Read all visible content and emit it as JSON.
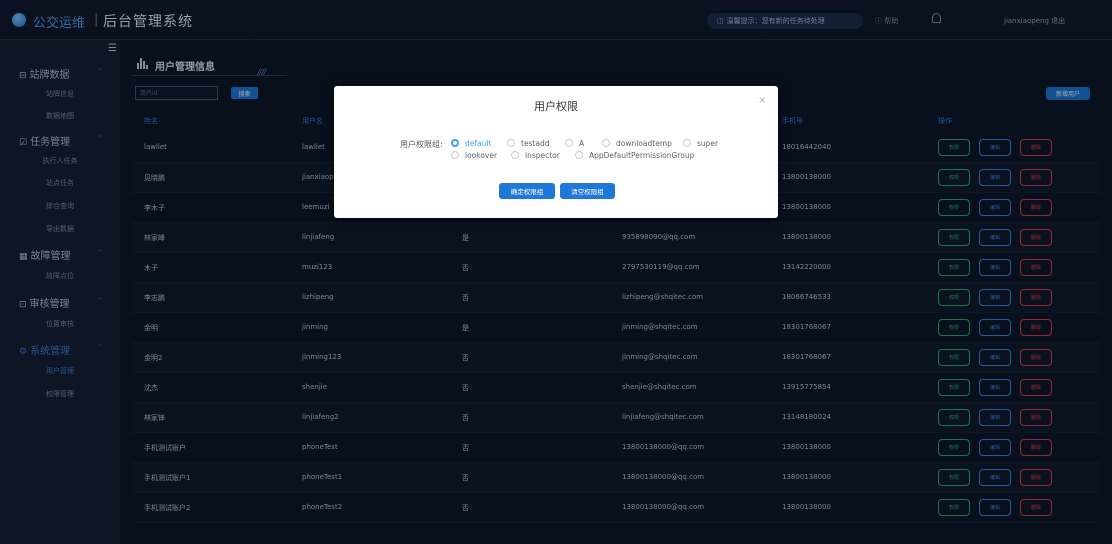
{
  "header": {
    "brand": "公交运维",
    "separator": "|",
    "app_title": "后台管理系统",
    "notice": "温馨提示：您有新的任务待处理",
    "help": "帮助",
    "user": "jianxiaopeng  退出"
  },
  "sidebar": {
    "groups": [
      {
        "label": "站牌数据",
        "items": [
          "站牌信息",
          "数据地图"
        ]
      },
      {
        "label": "任务管理",
        "items": [
          "执行人任务",
          "站点任务",
          "综合查询",
          "导出数据"
        ]
      },
      {
        "label": "故障管理",
        "items": [
          "故障点位"
        ]
      },
      {
        "label": "审核管理",
        "items": [
          "位置审核"
        ]
      },
      {
        "label": "系统管理",
        "items": [
          "用户管理",
          "权限管理"
        ]
      }
    ],
    "active_item": "用户管理"
  },
  "page": {
    "title": "用户管理信息",
    "search_placeholder": "用户id",
    "search_button": "搜索",
    "add_user_button": "新增用户"
  },
  "table": {
    "columns": [
      "姓名",
      "用户名",
      "",
      "",
      "手机号",
      "操作"
    ],
    "op_labels": {
      "permission": "权限",
      "edit": "编辑",
      "delete": "删除"
    },
    "rows": [
      {
        "name": "lawliet",
        "username": "lawliet",
        "flag": "",
        "email": "",
        "phone": "18016442040"
      },
      {
        "name": "见晓鹏",
        "username": "jianxiaop",
        "flag": "",
        "email": "",
        "phone": "13800138000"
      },
      {
        "name": "李木子",
        "username": "leemuzi",
        "flag": "",
        "email": "",
        "phone": "13800138000"
      },
      {
        "name": "林家峰",
        "username": "linjiafeng",
        "flag": "是",
        "email": "935898090@qq.com",
        "phone": "13800138000"
      },
      {
        "name": "木子",
        "username": "muzi123",
        "flag": "否",
        "email": "2797530119@qq.com",
        "phone": "13142220000"
      },
      {
        "name": "李志鹏",
        "username": "lizhipeng",
        "flag": "否",
        "email": "lizhipeng@shqitec.com",
        "phone": "18066746533"
      },
      {
        "name": "金明",
        "username": "jinming",
        "flag": "是",
        "email": "jinming@shqitec.com",
        "phone": "18301768067"
      },
      {
        "name": "金明2",
        "username": "jinming123",
        "flag": "否",
        "email": "jinming@shqitec.com",
        "phone": "18301768067"
      },
      {
        "name": "沈杰",
        "username": "shenjie",
        "flag": "否",
        "email": "shenjie@shqitec.com",
        "phone": "13915775854"
      },
      {
        "name": "林家锋",
        "username": "linjiafeng2",
        "flag": "否",
        "email": "linjiafeng@shqitec.com",
        "phone": "13148180024"
      },
      {
        "name": "手机测试账户",
        "username": "phoneTest",
        "flag": "否",
        "email": "13800138000@qq.com",
        "phone": "13800138000"
      },
      {
        "name": "手机测试账户1",
        "username": "phoneTest1",
        "flag": "否",
        "email": "13800138000@qq.com",
        "phone": "13800138000"
      },
      {
        "name": "手机测试账户2",
        "username": "phoneTest2",
        "flag": "否",
        "email": "13800138000@qq.com",
        "phone": "13800138000"
      }
    ]
  },
  "modal": {
    "title": "用户权限",
    "close": "×",
    "group_label": "用户权限组:",
    "options": [
      "default",
      "testadd",
      "A",
      "downloadtemp",
      "super",
      "lookover",
      "inspector",
      "AppDefaultPermissionGroup"
    ],
    "selected": "default",
    "confirm_button": "确定权限组",
    "clear_button": "清空权限组"
  },
  "colors": {
    "accent": "#1d78d8",
    "perm": "#2fae6b",
    "edit": "#3e86e0",
    "delete": "#e03b4a"
  }
}
